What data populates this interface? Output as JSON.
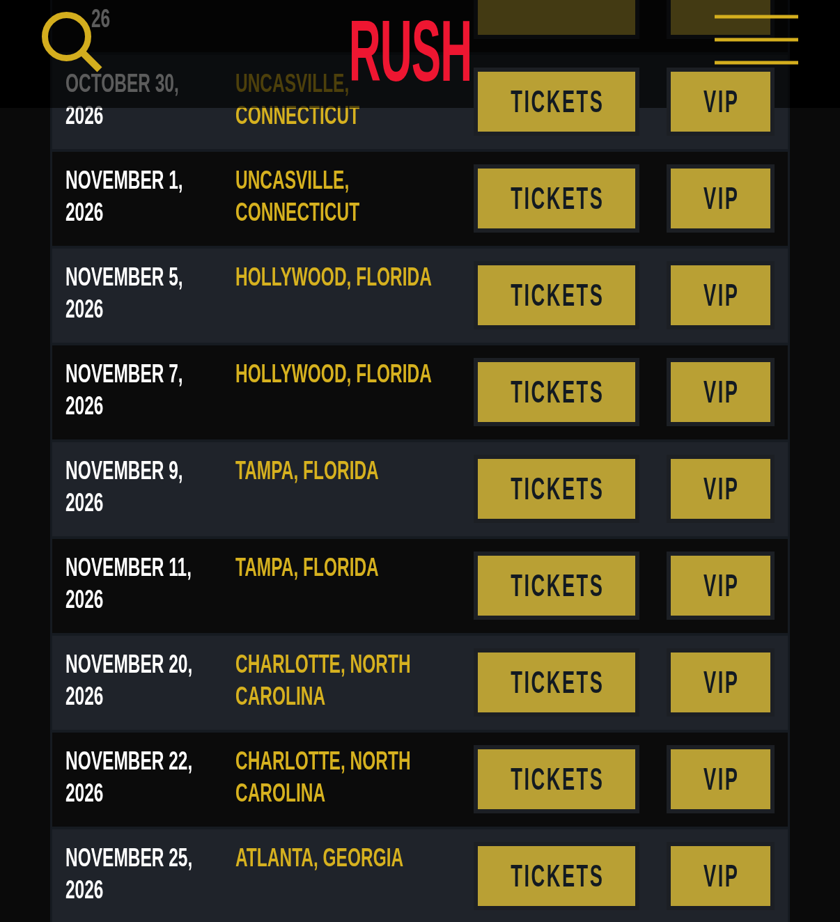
{
  "header": {
    "logo": "RUSH"
  },
  "tour_dates": [
    {
      "kind": "cut_top",
      "date": "26"
    },
    {
      "kind": "full",
      "date": "OCTOBER 30, 2026",
      "location": "UNCASVILLE, CONNECTICUT",
      "tickets_button": "TICKETS",
      "vip_button": "VIP"
    },
    {
      "kind": "full",
      "date": "NOVEMBER 1, 2026",
      "location": "UNCASVILLE, CONNECTICUT",
      "tickets_button": "TICKETS",
      "vip_button": "VIP"
    },
    {
      "kind": "full",
      "date": "NOVEMBER 5, 2026",
      "location": "HOLLYWOOD, FLORIDA",
      "tickets_button": "TICKETS",
      "vip_button": "VIP"
    },
    {
      "kind": "full",
      "date": "NOVEMBER 7, 2026",
      "location": "HOLLYWOOD, FLORIDA",
      "tickets_button": "TICKETS",
      "vip_button": "VIP"
    },
    {
      "kind": "full",
      "date": "NOVEMBER 9, 2026",
      "location": "TAMPA, FLORIDA",
      "tickets_button": "TICKETS",
      "vip_button": "VIP"
    },
    {
      "kind": "full",
      "date": "NOVEMBER 11, 2026",
      "location": "TAMPA, FLORIDA",
      "tickets_button": "TICKETS",
      "vip_button": "VIP"
    },
    {
      "kind": "full",
      "date": "NOVEMBER 20, 2026",
      "location": "CHARLOTTE, NORTH CAROLINA",
      "tickets_button": "TICKETS",
      "vip_button": "VIP"
    },
    {
      "kind": "full",
      "date": "NOVEMBER 22, 2026",
      "location": "CHARLOTTE, NORTH CAROLINA",
      "tickets_button": "TICKETS",
      "vip_button": "VIP"
    },
    {
      "kind": "full",
      "date": "NOVEMBER 25, 2026",
      "location": "ATLANTA, GEORGIA",
      "tickets_button": "TICKETS",
      "vip_button": "VIP"
    }
  ]
}
